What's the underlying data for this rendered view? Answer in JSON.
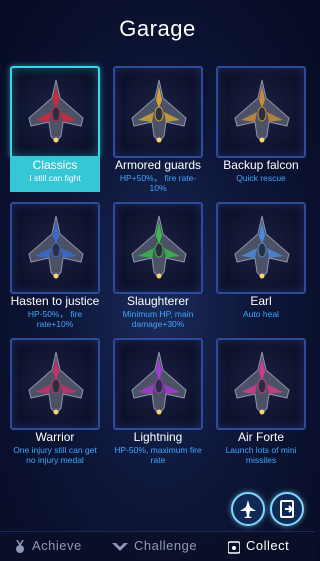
{
  "header": {
    "title": "Garage"
  },
  "ships": [
    {
      "name": "Classics",
      "desc": "I still can fight",
      "selected": true,
      "color": "#d6263a"
    },
    {
      "name": "Armored guards",
      "desc": "HP+50%， fire rate-10%",
      "selected": false,
      "color": "#d4a23a"
    },
    {
      "name": "Backup falcon",
      "desc": "Quick rescue",
      "selected": false,
      "color": "#c88a3a"
    },
    {
      "name": "Hasten to justice",
      "desc": "HP-50%， fire rate+10%",
      "selected": false,
      "color": "#3a6ad4"
    },
    {
      "name": "Slaughterer",
      "desc": "Minimum HP, main damage+30%",
      "selected": false,
      "color": "#3ab84a"
    },
    {
      "name": "Earl",
      "desc": "Auto heal",
      "selected": false,
      "color": "#4a8ad8"
    },
    {
      "name": "Warrior",
      "desc": "One injury still can get no injury medal",
      "selected": false,
      "color": "#c8306a"
    },
    {
      "name": "Lightning",
      "desc": "HP-50%, maximum fire rate",
      "selected": false,
      "color": "#a83ad4"
    },
    {
      "name": "Air Forte",
      "desc": "Launch lots of mini missiles",
      "selected": false,
      "color": "#d23a8a"
    }
  ],
  "actions": {
    "left_icon": "jet-icon",
    "right_icon": "share-icon"
  },
  "tabs": [
    {
      "label": "Achieve",
      "icon": "medal-icon",
      "active": false
    },
    {
      "label": "Challenge",
      "icon": "chevron-wings-icon",
      "active": false
    },
    {
      "label": "Collect",
      "icon": "chest-icon",
      "active": true
    }
  ]
}
